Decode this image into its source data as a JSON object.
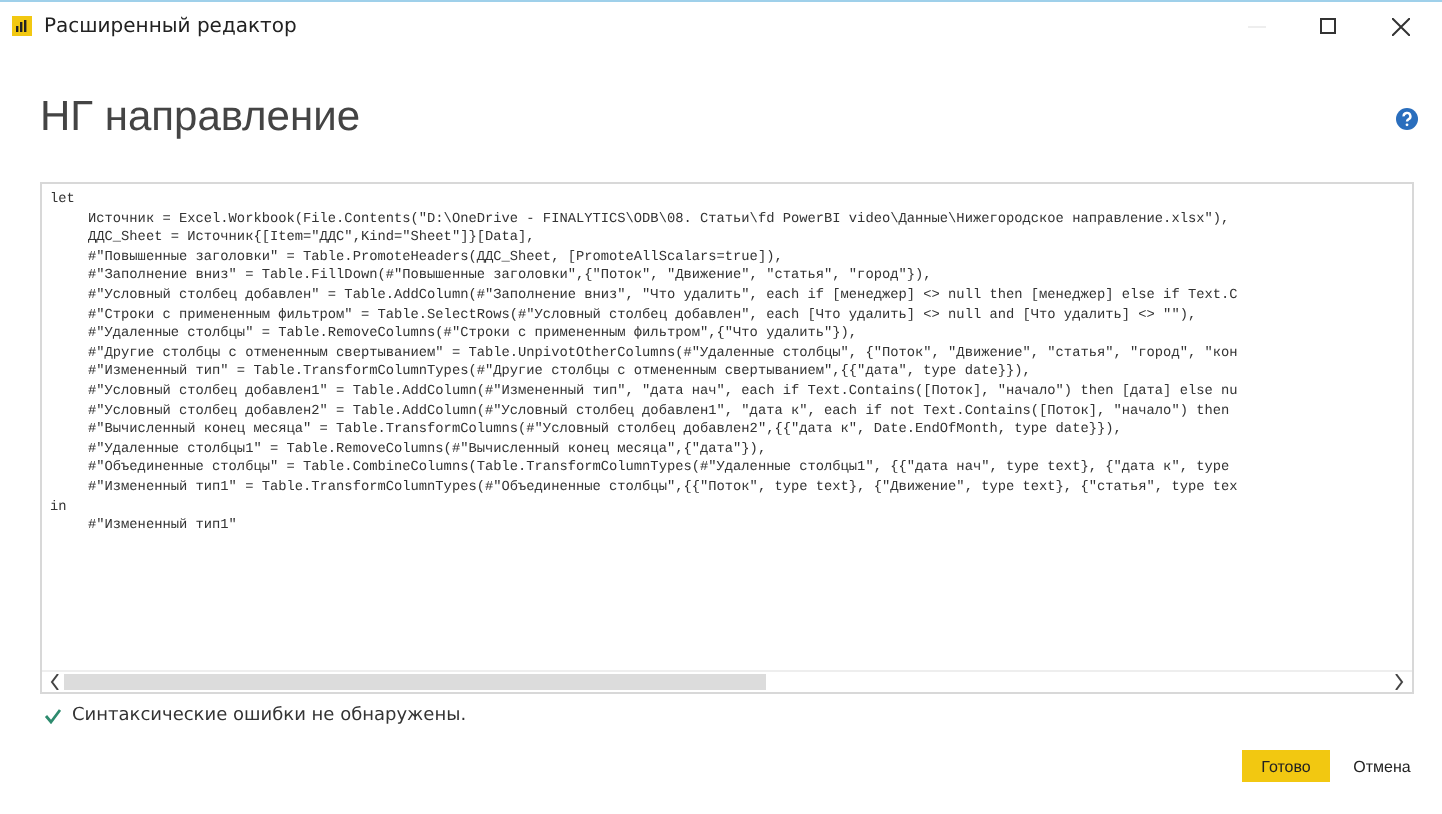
{
  "window": {
    "title": "Расширенный редактор"
  },
  "heading": "НГ направление",
  "editor": {
    "lines": [
      {
        "kind": "keyword",
        "text": "let"
      },
      {
        "kind": "statement",
        "text": "Источник = Excel.Workbook(File.Contents(\"D:\\OneDrive - FINALYTICS\\ODB\\08. Статьи\\fd PowerBI video\\Данные\\Нижегородское направление.xlsx\"),"
      },
      {
        "kind": "statement",
        "text": "ДДС_Sheet = Источник{[Item=\"ДДС\",Kind=\"Sheet\"]}[Data],"
      },
      {
        "kind": "statement",
        "text": "#\"Повышенные заголовки\" = Table.PromoteHeaders(ДДС_Sheet, [PromoteAllScalars=true]),"
      },
      {
        "kind": "statement",
        "text": "#\"Заполнение вниз\" = Table.FillDown(#\"Повышенные заголовки\",{\"Поток\", \"Движение\", \"статья\", \"город\"}),"
      },
      {
        "kind": "statement",
        "text": "#\"Условный столбец добавлен\" = Table.AddColumn(#\"Заполнение вниз\", \"Что удалить\", each if [менеджер] <> null then [менеджер] else if Text.C"
      },
      {
        "kind": "statement",
        "text": "#\"Строки с примененным фильтром\" = Table.SelectRows(#\"Условный столбец добавлен\", each [Что удалить] <> null and [Что удалить] <> \"\"),"
      },
      {
        "kind": "statement",
        "text": "#\"Удаленные столбцы\" = Table.RemoveColumns(#\"Строки с примененным фильтром\",{\"Что удалить\"}),"
      },
      {
        "kind": "statement",
        "text": "#\"Другие столбцы с отмененным свертыванием\" = Table.UnpivotOtherColumns(#\"Удаленные столбцы\", {\"Поток\", \"Движение\", \"статья\", \"город\", \"кон"
      },
      {
        "kind": "statement",
        "text": "#\"Измененный тип\" = Table.TransformColumnTypes(#\"Другие столбцы с отмененным свертыванием\",{{\"дата\", type date}}),"
      },
      {
        "kind": "statement",
        "text": "#\"Условный столбец добавлен1\" = Table.AddColumn(#\"Измененный тип\", \"дата нач\", each if Text.Contains([Поток], \"начало\") then [дата] else nu"
      },
      {
        "kind": "statement",
        "text": "#\"Условный столбец добавлен2\" = Table.AddColumn(#\"Условный столбец добавлен1\", \"дата к\", each if not Text.Contains([Поток], \"начало\") then"
      },
      {
        "kind": "statement",
        "text": "#\"Вычисленный конец месяца\" = Table.TransformColumns(#\"Условный столбец добавлен2\",{{\"дата к\", Date.EndOfMonth, type date}}),"
      },
      {
        "kind": "statement",
        "text": "#\"Удаленные столбцы1\" = Table.RemoveColumns(#\"Вычисленный конец месяца\",{\"дата\"}),"
      },
      {
        "kind": "statement",
        "text": "#\"Объединенные столбцы\" = Table.CombineColumns(Table.TransformColumnTypes(#\"Удаленные столбцы1\", {{\"дата нач\", type text}, {\"дата к\", type"
      },
      {
        "kind": "statement",
        "text": "#\"Измененный тип1\" = Table.TransformColumnTypes(#\"Объединенные столбцы\",{{\"Поток\", type text}, {\"Движение\", type text}, {\"статья\", type tex"
      },
      {
        "kind": "keyword",
        "text": "in"
      },
      {
        "kind": "statement",
        "text": "#\"Измененный тип1\""
      }
    ]
  },
  "status": {
    "ok": true,
    "text": "Синтаксические ошибки не обнаружены."
  },
  "buttons": [
    {
      "label": "Готово",
      "primary": true
    },
    {
      "label": "Отмена",
      "primary": false
    }
  ]
}
